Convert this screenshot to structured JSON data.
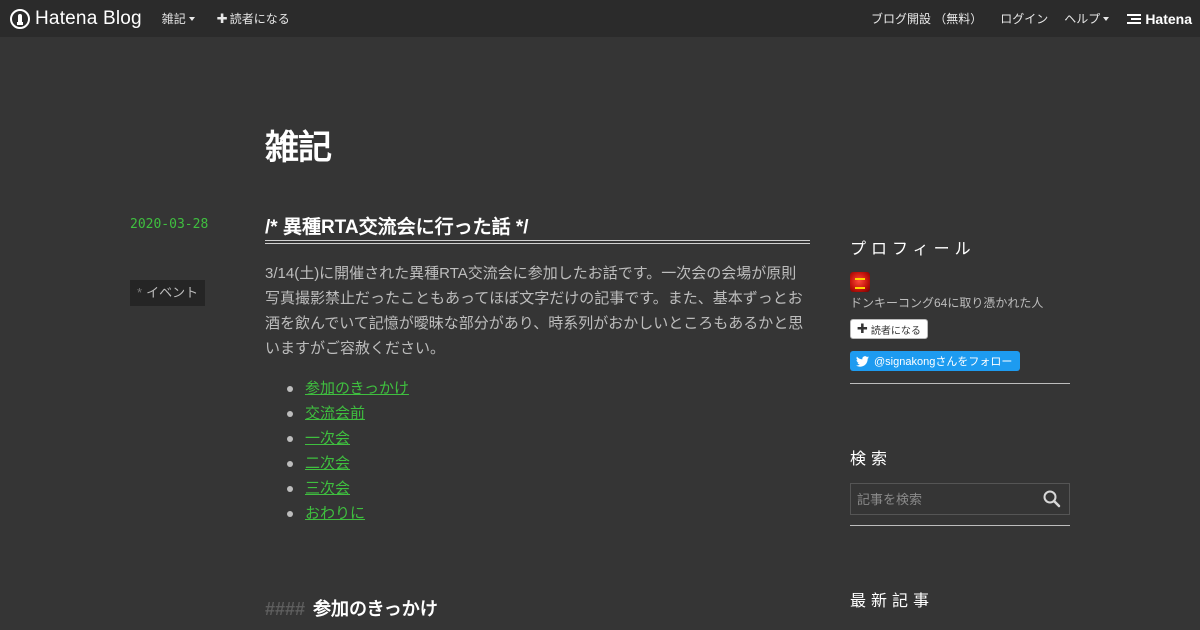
{
  "topbar": {
    "brand": "Hatena Blog",
    "blog_menu": "雑記",
    "subscribe": "読者になる",
    "start_blog": "ブログ開設 （無料）",
    "login": "ログイン",
    "help": "ヘルプ",
    "hatena": "Hatena"
  },
  "blog": {
    "title": "雑記"
  },
  "entry": {
    "date": "2020-03-28",
    "title": "/*  異種RTA交流会に行った話  */",
    "category_marker": "*",
    "category": "イベント",
    "body": "3/14(土)に開催された異種RTA交流会に参加したお話です。一次会の会場が原則写真撮影禁止だったこともあってほぼ文字だけの記事です。また、基本ずっとお酒を飲んでいて記憶が曖昧な部分があり、時系列がおかしいところもあるかと思いますがご容赦ください。",
    "toc": [
      "参加のきっかけ",
      "交流会前",
      "一次会",
      "二次会",
      "三次会",
      "おわりに"
    ],
    "section_hashes": "####",
    "section_title": "参加のきっかけ"
  },
  "sidebar": {
    "profile_heading": "プロフィール",
    "profile_description": "ドンキーコング64に取り憑かれた人",
    "subscribe_button": "読者になる",
    "twitter_follow": "@signakongさんをフォロー",
    "search_heading": "検索",
    "search_placeholder": "記事を検索",
    "recent_heading": "最新記事"
  },
  "colors": {
    "background": "#353535",
    "topbar": "#2b2b2b",
    "accent_green": "#3fbf3f",
    "twitter_blue": "#1d9bf0"
  }
}
